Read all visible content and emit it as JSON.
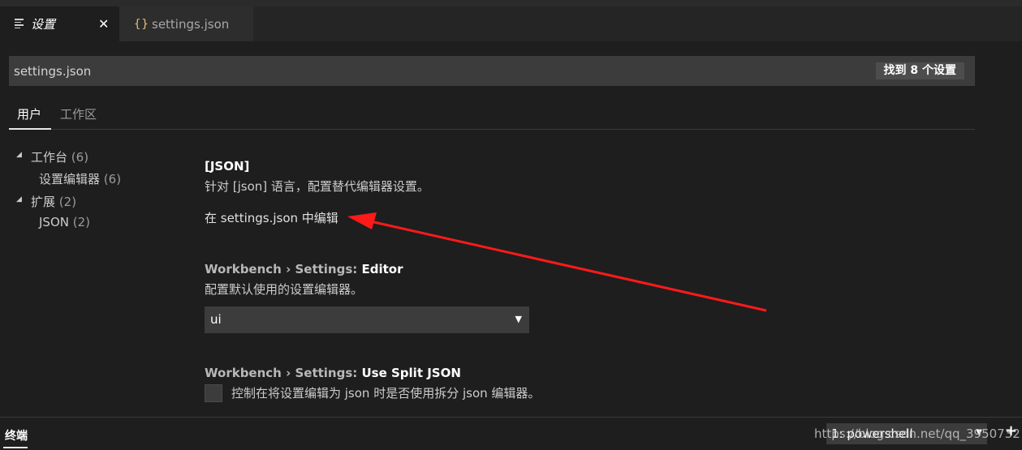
{
  "tabs": [
    {
      "label": "设置",
      "close": "✕",
      "icon": "settings-lines-icon"
    },
    {
      "label": "settings.json",
      "icon_text": "{}",
      "icon": "json-braces-icon"
    }
  ],
  "search": {
    "value": "settings.json",
    "result_count": "找到 8 个设置"
  },
  "scope_tabs": {
    "user": "用户",
    "workspace": "工作区"
  },
  "toc": [
    {
      "label": "工作台",
      "count": "(6)",
      "expanded": true
    },
    {
      "label": "设置编辑器",
      "count": "(6)"
    },
    {
      "label": "扩展",
      "count": "(2)",
      "expanded": true
    },
    {
      "label": "JSON",
      "count": "(2)"
    }
  ],
  "settings": {
    "json": {
      "title": "[JSON]",
      "description": "针对 [json] 语言，配置替代编辑器设置。",
      "edit_link": "在 settings.json 中编辑"
    },
    "editor": {
      "category": "Workbench › Settings: ",
      "name": "Editor",
      "description": "配置默认使用的设置编辑器。",
      "value": "ui"
    },
    "split_json": {
      "category": "Workbench › Settings: ",
      "name": "Use Split JSON",
      "description": "控制在将设置编辑为 json 时是否使用拆分 json 编辑器。"
    }
  },
  "panel": {
    "title": "终端",
    "terminal_value": "1: powershell",
    "watermark": "https://blog.csdn.net/qq_3950732",
    "add_symbol": "+"
  },
  "colors": {
    "annotation_arrow": "#ff1a1a",
    "accent": "#e5c07b"
  }
}
